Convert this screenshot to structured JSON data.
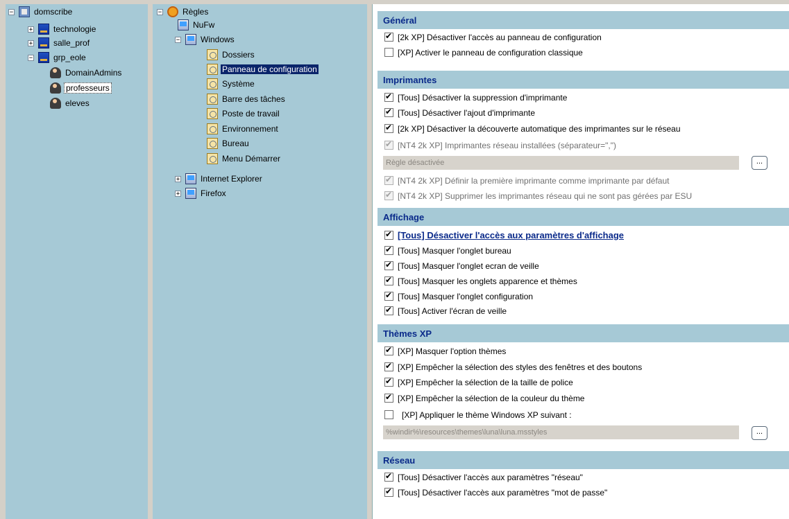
{
  "groups_tree": {
    "root": "domscribe",
    "items": [
      {
        "label": "technologie",
        "pm": "+"
      },
      {
        "label": "salle_prof",
        "pm": "+"
      },
      {
        "label": "grp_eole",
        "pm": "−"
      }
    ],
    "users": [
      {
        "label": "DomainAdmins"
      },
      {
        "label": "professeurs"
      },
      {
        "label": "eleves"
      }
    ]
  },
  "rules_tree": {
    "root": "Règles",
    "nufw": "NuFw",
    "windows": "Windows",
    "windows_children": [
      "Dossiers",
      "Panneau de configuration",
      "Système",
      "Barre des tâches",
      "Poste de travail",
      "Environnement",
      "Bureau",
      "Menu Démarrer"
    ],
    "ie": "Internet Explorer",
    "firefox": "Firefox"
  },
  "sections": {
    "general": {
      "title": "Général",
      "rows": [
        {
          "label": "[2k XP] Désactiver l'accès au panneau de configuration",
          "checked": true
        },
        {
          "label": "[XP] Activer le panneau de configuration classique",
          "checked": false
        }
      ]
    },
    "printers": {
      "title": "Imprimantes",
      "rows": [
        {
          "label": "[Tous] Désactiver la suppression d'imprimante",
          "checked": true
        },
        {
          "label": "[Tous] Désactiver l'ajout d'imprimante",
          "checked": true
        },
        {
          "label": "[2k XP] Désactiver la découverte automatique des imprimantes sur le réseau",
          "checked": true
        },
        {
          "label": "[NT4 2k XP] Imprimantes réseau installées (séparateur=\",\")",
          "checked": true
        }
      ],
      "field_value": "Règle désactivée",
      "ellipsis": "...",
      "rows2": [
        {
          "label": "[NT4 2k XP] Définir la première imprimante comme imprimante par défaut",
          "checked": true
        },
        {
          "label": "[NT4 2k XP] Supprimer les imprimantes réseau qui ne sont pas gérées par ESU",
          "checked": true
        }
      ]
    },
    "display": {
      "title": "Affichage",
      "rows": [
        {
          "label": "[Tous] Désactiver l'accès aux paramètres d'affichage",
          "checked": true
        },
        {
          "label": "[Tous] Masquer l'onglet bureau",
          "checked": true
        },
        {
          "label": "[Tous] Masquer l'onglet ecran de veille",
          "checked": true
        },
        {
          "label": "[Tous] Masquer les onglets apparence et thèmes",
          "checked": true
        },
        {
          "label": "[Tous] Masquer l'onglet configuration",
          "checked": true
        },
        {
          "label": "[Tous] Activer l'écran de veille",
          "checked": true
        }
      ]
    },
    "themes": {
      "title": "Thèmes XP",
      "rows": [
        {
          "label": "[XP] Masquer l'option thèmes",
          "checked": true
        },
        {
          "label": "[XP] Empêcher la sélection des styles des fenêtres et des boutons",
          "checked": true
        },
        {
          "label": "[XP] Empêcher la sélection de la taille de police",
          "checked": true
        },
        {
          "label": "[XP] Empêcher la sélection de la couleur du thème",
          "checked": true
        },
        {
          "label": "[XP] Appliquer le thème Windows XP suivant :",
          "checked": false
        }
      ],
      "field_value": "%windir%\\resources\\themes\\luna\\luna.msstyles",
      "ellipsis": "..."
    },
    "network": {
      "title": "Réseau",
      "rows": [
        {
          "label": "[Tous] Désactiver l'accès aux paramètres \"réseau\"",
          "checked": true
        },
        {
          "label": "[Tous] Désactiver l'accès aux paramètres \"mot de passe\"",
          "checked": true
        }
      ]
    }
  }
}
